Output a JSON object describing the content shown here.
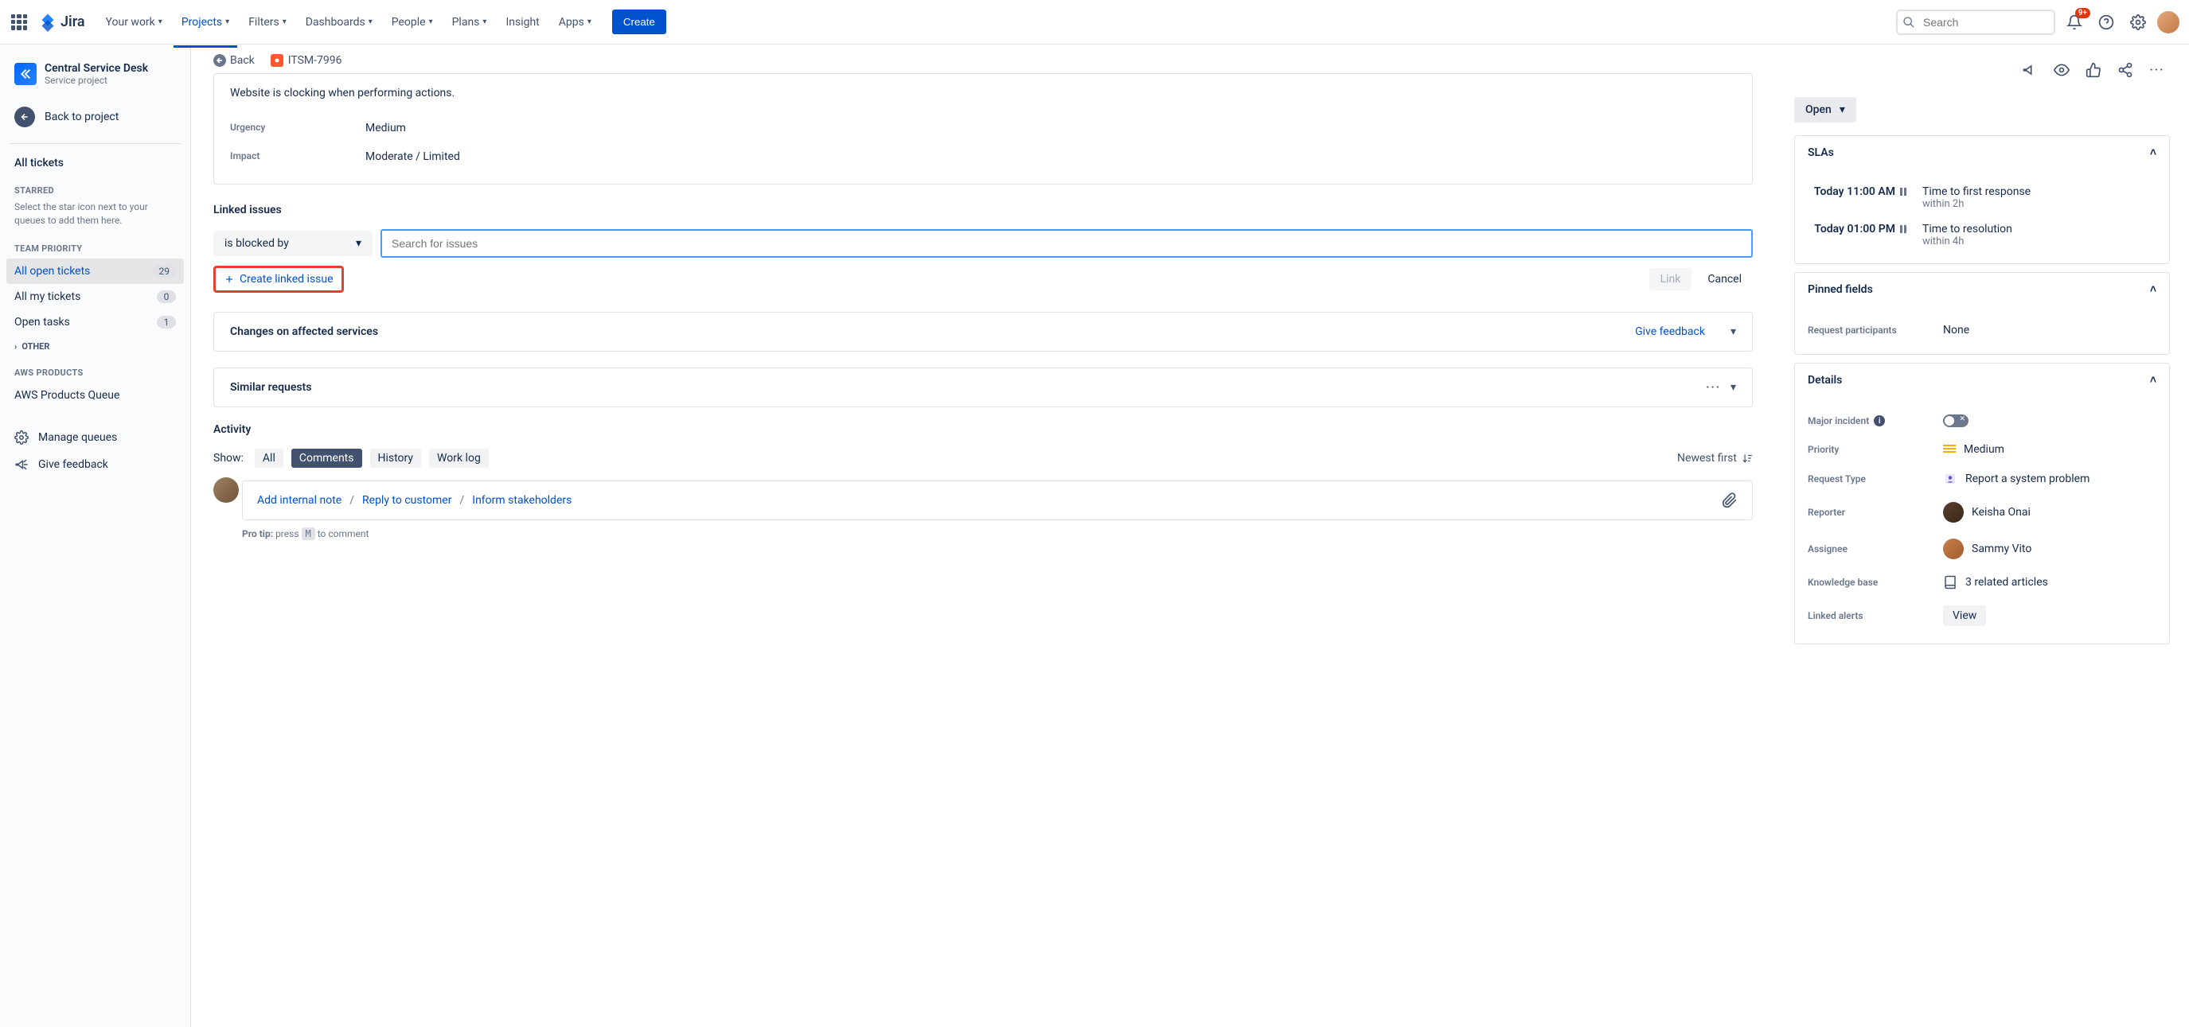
{
  "topnav": {
    "logo_text": "Jira",
    "items": [
      "Your work",
      "Projects",
      "Filters",
      "Dashboards",
      "People",
      "Plans",
      "Insight",
      "Apps"
    ],
    "active_index": 1,
    "create": "Create",
    "search_placeholder": "Search",
    "notif_badge": "9+"
  },
  "sidebar": {
    "project_name": "Central Service Desk",
    "project_sub": "Service project",
    "back": "Back to project",
    "all_tickets": "All tickets",
    "starred_label": "STARRED",
    "starred_hint": "Select the star icon next to your queues to add them here.",
    "team_label": "TEAM PRIORITY",
    "queues": [
      {
        "name": "All open tickets",
        "count": "29",
        "active": true
      },
      {
        "name": "All my tickets",
        "count": "0"
      },
      {
        "name": "Open tasks",
        "count": "1"
      }
    ],
    "other": "OTHER",
    "aws_label": "AWS PRODUCTS",
    "aws_queue": "AWS Products Queue",
    "manage": "Manage queues",
    "feedback": "Give feedback"
  },
  "breadcrumb": {
    "back": "Back",
    "issue_key": "ITSM-7996"
  },
  "issue": {
    "description": "Website is clocking when performing actions.",
    "urgency_label": "Urgency",
    "urgency_value": "Medium",
    "impact_label": "Impact",
    "impact_value": "Moderate / Limited"
  },
  "linked": {
    "heading": "Linked issues",
    "relation": "is blocked by",
    "search_placeholder": "Search for issues",
    "create": "Create linked issue",
    "link_btn": "Link",
    "cancel_btn": "Cancel"
  },
  "changes": {
    "title": "Changes on affected services",
    "feedback": "Give feedback"
  },
  "similar": {
    "title": "Similar requests"
  },
  "activity": {
    "heading": "Activity",
    "show": "Show:",
    "tabs": [
      "All",
      "Comments",
      "History",
      "Work log"
    ],
    "active_tab": 1,
    "sort": "Newest first",
    "internal_note": "Add internal note",
    "reply": "Reply to customer",
    "inform": "Inform stakeholders",
    "pro_tip_label": "Pro tip:",
    "pro_tip_prefix": "press",
    "pro_tip_key": "M",
    "pro_tip_suffix": "to comment"
  },
  "right": {
    "status": "Open",
    "slas_heading": "SLAs",
    "slas": [
      {
        "time": "Today 11:00 AM",
        "title": "Time to first response",
        "sub": "within 2h"
      },
      {
        "time": "Today 01:00 PM",
        "title": "Time to resolution",
        "sub": "within 4h"
      }
    ],
    "pinned_heading": "Pinned fields",
    "participants_label": "Request participants",
    "participants_value": "None",
    "details_heading": "Details",
    "details": {
      "major_incident_label": "Major incident",
      "priority_label": "Priority",
      "priority_value": "Medium",
      "request_type_label": "Request Type",
      "request_type_value": "Report a system problem",
      "reporter_label": "Reporter",
      "reporter_value": "Keisha Onai",
      "assignee_label": "Assignee",
      "assignee_value": "Sammy Vito",
      "kb_label": "Knowledge base",
      "kb_value": "3 related articles",
      "alerts_label": "Linked alerts",
      "alerts_value": "View"
    }
  }
}
